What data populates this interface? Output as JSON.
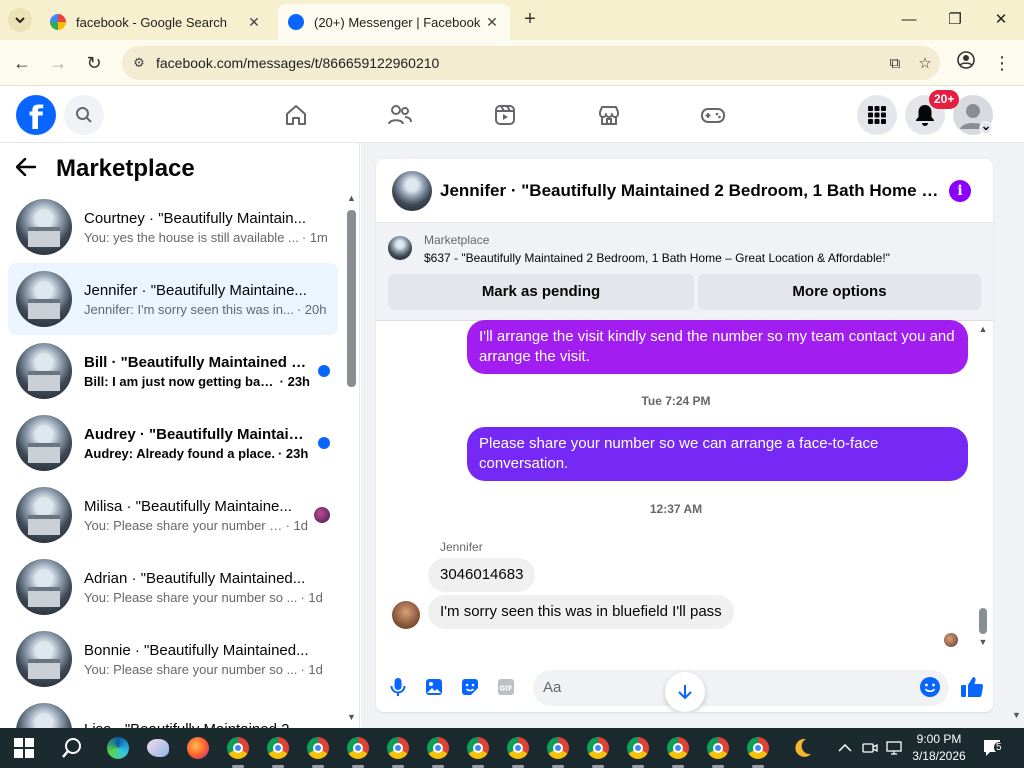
{
  "browser": {
    "tabs": [
      {
        "title": "facebook - Google Search",
        "active": false
      },
      {
        "title": "(20+) Messenger | Facebook",
        "active": true
      }
    ],
    "url": "facebook.com/messages/t/866659122960210"
  },
  "fb": {
    "notification_badge": "20+"
  },
  "sidebar": {
    "title": "Marketplace",
    "conversations": [
      {
        "name": "Courtney · \"Beautifully Maintain...",
        "preview": "You: yes the house is still available ...",
        "time": "· 1m",
        "unread": false,
        "active": false
      },
      {
        "name": "Jennifer · \"Beautifully Maintaine...",
        "preview": "Jennifer: I'm sorry seen this was in...",
        "time": "· 20h",
        "unread": false,
        "active": true
      },
      {
        "name": "Bill · \"Beautifully Maintained 2...",
        "preview": "Bill: I am just now getting back...",
        "time": "· 23h",
        "unread": true,
        "active": false
      },
      {
        "name": "Audrey · \"Beautifully Maintain...",
        "preview": "Audrey: Already found a place.",
        "time": "· 23h",
        "unread": true,
        "active": false
      },
      {
        "name": "Milisa · \"Beautifully Maintaine...",
        "preview": "You: Please share your number s...",
        "time": "· 1d",
        "unread": false,
        "active": false
      },
      {
        "name": "Adrian · \"Beautifully Maintained...",
        "preview": "You: Please share your number so ...",
        "time": "· 1d",
        "unread": false,
        "active": false
      },
      {
        "name": "Bonnie · \"Beautifully Maintained...",
        "preview": "You: Please share your number so ...",
        "time": "· 1d",
        "unread": false,
        "active": false
      },
      {
        "name": "Lisa · \"Beautifully Maintained 2 ...",
        "preview": "",
        "time": "",
        "unread": false,
        "active": false
      }
    ]
  },
  "chat": {
    "header_title": "Jennifer · \"Beautifully Maintained 2 Bedroom, 1 Bath Home – ...",
    "marketplace_label": "Marketplace",
    "listing": "$637 - \"Beautifully Maintained 2 Bedroom, 1 Bath Home – Great Location & Affordable!\"",
    "mark_pending": "Mark as pending",
    "more_options": "More options",
    "messages": {
      "out1": "I'll arrange the visit kindly send the number so my team contact you and arrange the visit.",
      "ts1": "Tue 7:24 PM",
      "out2": "Please share your number so we can arrange a face-to-face conversation.",
      "ts2": "12:37 AM",
      "sender": "Jennifer",
      "in1": "3046014683",
      "in2": "I'm sorry seen this was in bluefield I'll pass"
    },
    "composer_placeholder": "Aa",
    "colors": {
      "bubble_top": "#a020f0",
      "bubble_bottom": "#7b2ff7",
      "accent": "#0866ff"
    }
  },
  "taskbar": {
    "time": "9:00 PM",
    "date": "3/18/2026",
    "notifications": "5"
  }
}
